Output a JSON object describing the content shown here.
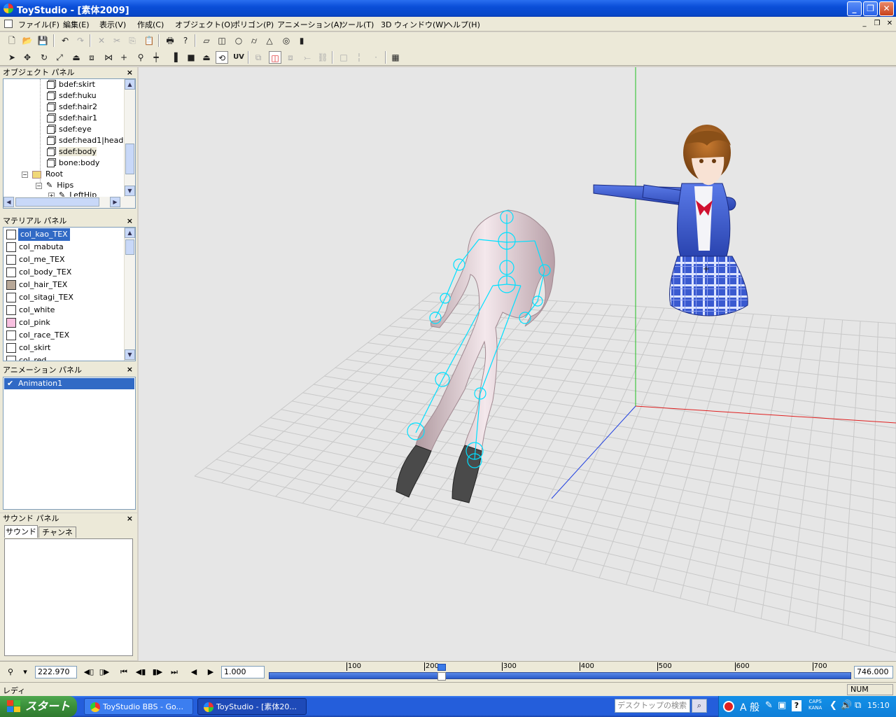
{
  "window": {
    "title": "ToyStudio - [素体2009]",
    "controls": [
      "minimize",
      "restore",
      "close"
    ]
  },
  "menu": [
    "ファイル(F)",
    "編集(E)",
    "表示(V)",
    "作成(C)",
    "オブジェクト(O)",
    "ポリゴン(P)",
    "アニメーション(A)",
    "ツール(T)",
    "3D ウィンドウ(W)",
    "ヘルプ(H)"
  ],
  "toolbar2": {
    "uv_label": "UV"
  },
  "object_panel": {
    "title": "オブジェクト パネル",
    "close": "×",
    "items": [
      {
        "label": "bdef:skirt",
        "type": "object"
      },
      {
        "label": "sdef:huku",
        "type": "object"
      },
      {
        "label": "sdef:hair2",
        "type": "object"
      },
      {
        "label": "sdef:hair1",
        "type": "object"
      },
      {
        "label": "sdef:eye",
        "type": "object"
      },
      {
        "label": "sdef:head1|head",
        "type": "object"
      },
      {
        "label": "sdef:body",
        "type": "object"
      },
      {
        "label": "bone:body",
        "type": "object"
      },
      {
        "label": "Root",
        "type": "folder"
      },
      {
        "label": "Hips",
        "type": "bone"
      },
      {
        "label": "LeftHip",
        "type": "bone"
      }
    ]
  },
  "material_panel": {
    "title": "マテリアル パネル",
    "close": "×",
    "items": [
      {
        "label": "col_kao_TEX",
        "color": "#ffffff",
        "selected": true
      },
      {
        "label": "col_mabuta",
        "color": "#ffffff"
      },
      {
        "label": "col_me_TEX",
        "color": "#ffffff"
      },
      {
        "label": "col_body_TEX",
        "color": "#ffffff"
      },
      {
        "label": "col_hair_TEX",
        "color": "#b8a898"
      },
      {
        "label": "col_sitagi_TEX",
        "color": "#ffffff"
      },
      {
        "label": "col_white",
        "color": "#ffffff"
      },
      {
        "label": "col_pink",
        "color": "#f8c0e0"
      },
      {
        "label": "col_race_TEX",
        "color": "#ffffff"
      },
      {
        "label": "col_skirt",
        "color": "#ffffff"
      },
      {
        "label": "col_red",
        "color": "#ffffff"
      }
    ]
  },
  "animation_panel": {
    "title": "アニメーション パネル",
    "close": "×",
    "items": [
      {
        "label": "Animation1",
        "checked": true
      }
    ]
  },
  "sound_panel": {
    "title": "サウンド パネル",
    "close": "×",
    "tabs": [
      "サウンド",
      "チャンネル"
    ]
  },
  "timeline": {
    "current_time": "222.970",
    "speed": "1.000",
    "end_time": "746.000",
    "ticks": [
      "100",
      "200",
      "300",
      "400",
      "500",
      "600",
      "700"
    ],
    "min": 0,
    "max": 750,
    "playhead": 222.97
  },
  "status": {
    "left": "レディ",
    "num": "NUM"
  },
  "taskbar": {
    "start": "スタート",
    "tasks": [
      {
        "label": "ToyStudio BBS - Go..."
      },
      {
        "label": "ToyStudio - [素体20..."
      }
    ],
    "search_placeholder": "デスクトップの検索",
    "ime": "A 般",
    "caps": "CAPS",
    "kana": "KANA",
    "clock": "15:10"
  },
  "colors": {
    "accent": "#316ac5",
    "bone": "#00e0ff",
    "titlebar": "#0a4ed8"
  }
}
